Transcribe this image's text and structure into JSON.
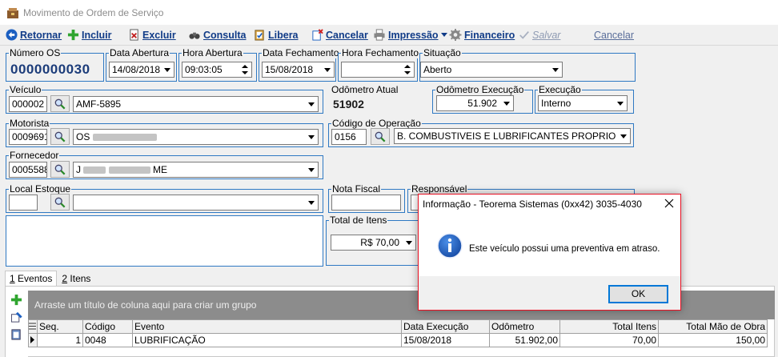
{
  "window": {
    "title": "Movimento de Ordem de Serviço"
  },
  "toolbar": {
    "retornar": "Retornar",
    "incluir": "Incluir",
    "excluir": "Excluir",
    "consulta": "Consulta",
    "libera": "Libera",
    "cancelar": "Cancelar",
    "impressao": "Impressão",
    "financeiro": "Financeiro",
    "salvar": "Salvar",
    "cancelar2": "Cancelar"
  },
  "os": {
    "numero_label": "Número OS",
    "numero": "0000000030",
    "data_abertura_label": "Data Abertura",
    "data_abertura": "14/08/2018",
    "hora_abertura_label": "Hora Abertura",
    "hora_abertura": "09:03:05",
    "data_fechamento_label": "Data Fechamento",
    "data_fechamento": "15/08/2018",
    "hora_fechamento_label": "Hora Fechamento",
    "hora_fechamento": "",
    "situacao_label": "Situação",
    "situacao": "Aberto"
  },
  "veiculo": {
    "label": "Veículo",
    "codigo": "000002",
    "placa": "AMF-5895",
    "odometro_atual_label": "Odômetro Atual",
    "odometro_atual": "51902",
    "odometro_execucao_label": "Odômetro Execução",
    "odometro_execucao": "51.902",
    "execucao_label": "Execução",
    "execucao": "Interno"
  },
  "motorista": {
    "label": "Motorista",
    "codigo": "0009691",
    "nome_prefix": "OS",
    "codigo_operacao_label": "Código de Operação",
    "operacao_codigo": "0156",
    "operacao_nome": "B. COMBUSTIVEIS E LUBRIFICANTES PROPRIO"
  },
  "fornecedor": {
    "label": "Fornecedor",
    "codigo": "0005588",
    "nome_prefix": "J",
    "nome_suffix": "ME"
  },
  "estoque": {
    "local_label": "Local Estoque",
    "nota_fiscal_label": "Nota Fiscal",
    "responsavel_label": "Responsável",
    "total_itens_label": "Total de Itens",
    "total_itens": "R$ 70,00"
  },
  "tabs": [
    {
      "key": "1",
      "rest": " Eventos"
    },
    {
      "key": "2",
      "rest": " Itens"
    }
  ],
  "grid": {
    "group_hint": "Arraste um título de coluna aqui para criar um grupo",
    "columns": [
      "Seq.",
      "Código",
      "Evento",
      "Data Execução",
      "Odômetro",
      "Total Itens",
      "Total Mão de Obra"
    ],
    "rows": [
      [
        "1",
        "0048",
        "LUBRIFICAÇÃO",
        "15/08/2018",
        "51.902,00",
        "70,00",
        "150,00"
      ]
    ]
  },
  "dialog": {
    "title": "Informação - Teorema Sistemas (0xx42) 3035-4030",
    "message": "Este veículo possui uma preventiva em atraso.",
    "ok": "OK"
  },
  "colors": {
    "accent": "#2f79c3",
    "value": "#1c3c7a",
    "toolbar_text": "#103b87",
    "dialog_border": "#e81123"
  }
}
